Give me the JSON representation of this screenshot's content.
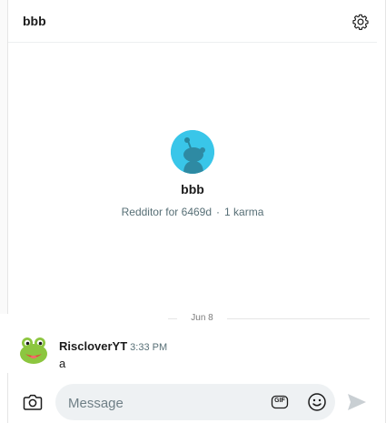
{
  "header": {
    "title": "bbb",
    "settings_icon": "gear-icon"
  },
  "profile": {
    "avatar_icon": "reddit-snoo-icon",
    "avatar_color": "#39c6e9",
    "name": "bbb",
    "age_text": "Redditor for 6469d",
    "separator": "·",
    "karma_text": "1 karma"
  },
  "divider": {
    "date": "Jun 8"
  },
  "messages": [
    {
      "author": "RiscloverYT",
      "time": "3:33 PM",
      "text": "a",
      "avatar_icon": "frog-avatar-icon"
    }
  ],
  "composer": {
    "camera_icon": "camera-icon",
    "placeholder": "Message",
    "gif_label": "GIF",
    "emoji_icon": "smiley-icon",
    "send_icon": "send-icon"
  }
}
